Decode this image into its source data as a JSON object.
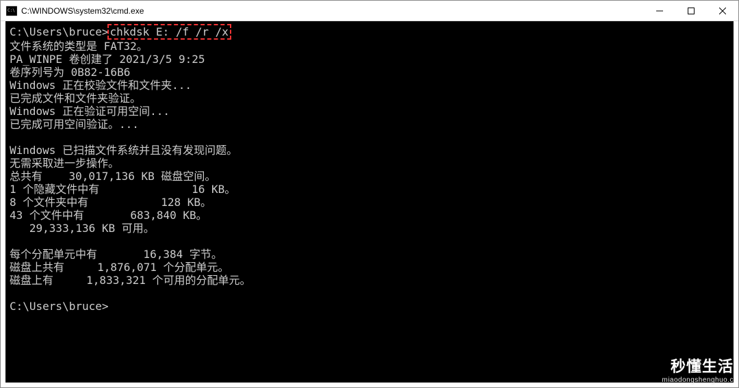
{
  "window": {
    "title": "C:\\WINDOWS\\system32\\cmd.exe"
  },
  "terminal": {
    "prompt1_prefix": "C:\\Users\\bruce>",
    "command_highlighted": "chkdsk E: /f /r /x",
    "lines": [
      "文件系统的类型是 FAT32。",
      "PA_WINPE 卷创建了 2021/3/5 9:25",
      "卷序列号为 0B82-16B6",
      "Windows 正在校验文件和文件夹...",
      "已完成文件和文件夹验证。",
      "Windows 正在验证可用空间...",
      "已完成可用空间验证。...",
      "",
      "Windows 已扫描文件系统并且没有发现问题。",
      "无需采取进一步操作。",
      "总共有    30,017,136 KB 磁盘空间。",
      "1 个隐藏文件中有              16 KB。",
      "8 个文件夹中有           128 KB。",
      "43 个文件中有       683,840 KB。",
      "   29,333,136 KB 可用。",
      "",
      "每个分配单元中有       16,384 字节。",
      "磁盘上共有     1,876,071 个分配单元。",
      "磁盘上有     1,833,321 个可用的分配单元。",
      ""
    ],
    "prompt2": "C:\\Users\\bruce>"
  },
  "watermark": {
    "large": "秒懂生活",
    "small": "miaodongshenghuo.c"
  }
}
